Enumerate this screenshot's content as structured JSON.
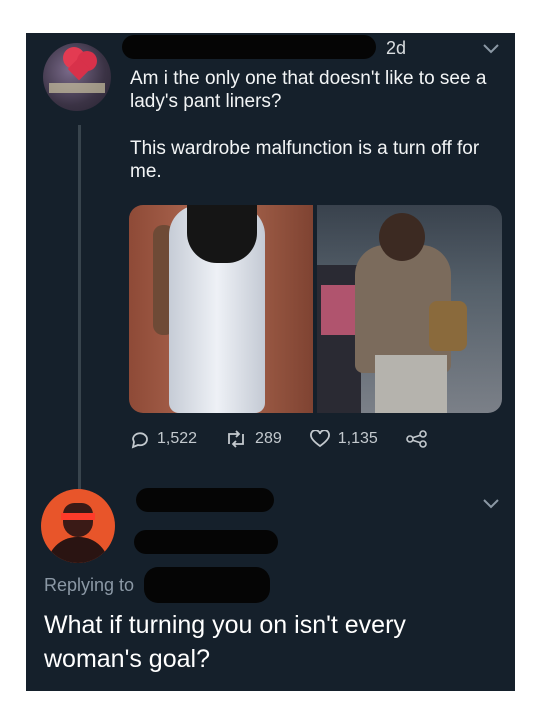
{
  "tweet": {
    "time": "2d",
    "paragraph1": "Am i the only one that doesn't like to see a lady's pant liners?",
    "paragraph2": "This wardrobe malfunction is a turn off for me.",
    "replies": "1,522",
    "retweets": "289",
    "likes": "1,135"
  },
  "reply": {
    "replying_to": "Replying to",
    "text": "What if turning you on isn't every woman's goal?"
  },
  "icons": {
    "reply": "reply-icon",
    "retweet": "retweet-icon",
    "like": "heart-icon",
    "share": "share-icon",
    "caret": "chevron-down-icon"
  },
  "colors": {
    "background": "#15202b",
    "text": "#ffffff",
    "secondary_text": "#8b98a5"
  }
}
